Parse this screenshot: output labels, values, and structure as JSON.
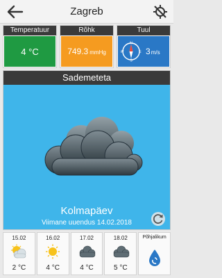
{
  "header": {
    "city": "Zagreb",
    "back_icon": "arrow-left-icon",
    "gps_icon": "gps-off-icon"
  },
  "cards": {
    "temperature": {
      "label": "Temperatuur",
      "value": "4 °C",
      "color": "#1f9a42"
    },
    "pressure": {
      "label": "Rõhk",
      "value": "749.3",
      "unit": "mmHg",
      "color": "#f59b20"
    },
    "wind": {
      "label": "Tuul",
      "value": "3",
      "unit": "m/s",
      "direction_letters": {
        "n": "N",
        "e": "E",
        "s": "S",
        "w": "W"
      },
      "color": "#2a78c6"
    }
  },
  "precipitation": {
    "title": "Sademeteta",
    "day": "Kolmapäev",
    "updated": "Viimane uuendus 14.02.2018",
    "panel_color": "#3fb5ea"
  },
  "forecast": [
    {
      "date": "15.02",
      "temp": "2 °C",
      "icon": "sun-cloud-icon"
    },
    {
      "date": "16.02",
      "temp": "4 °C",
      "icon": "sun-icon"
    },
    {
      "date": "17.02",
      "temp": "4 °C",
      "icon": "cloud-icon"
    },
    {
      "date": "18.02",
      "temp": "5 °C",
      "icon": "cloud-icon"
    }
  ],
  "wind_direction": {
    "label": "Põhjalikum",
    "icon": "water-drop-icon"
  }
}
